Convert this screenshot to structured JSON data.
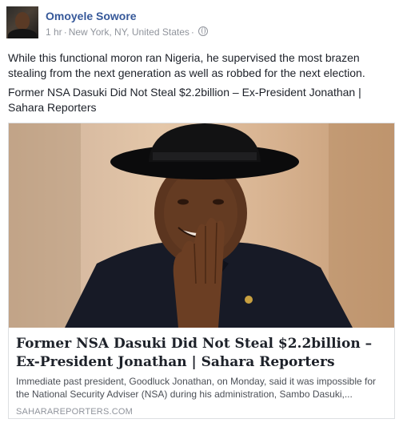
{
  "post": {
    "author": "Omoyele Sowore",
    "time": "1 hr",
    "location": "New York, NY, United States",
    "privacy_icon": "globe-icon",
    "text": "While this functional moron ran Nigeria, he supervised the most brazen stealing from the next generation as well as robbed for the next election.",
    "link_title": "Former NSA Dasuki Did Not Steal $2.2billion – Ex-President Jonathan | Sahara Reporters"
  },
  "card": {
    "title": "Former NSA Dasuki Did Not Steal $2.2billion – Ex-President Jonathan | Sahara Reporters",
    "description": "Immediate past president, Goodluck Jonathan, on Monday, said it was impossible for the National Security Adviser (NSA) during his administration, Sambo Dasuki,...",
    "domain": "SAHARAREPORTERS.COM"
  },
  "colors": {
    "author_link": "#365899",
    "meta_gray": "#90949c",
    "card_border": "#dddfe2"
  }
}
